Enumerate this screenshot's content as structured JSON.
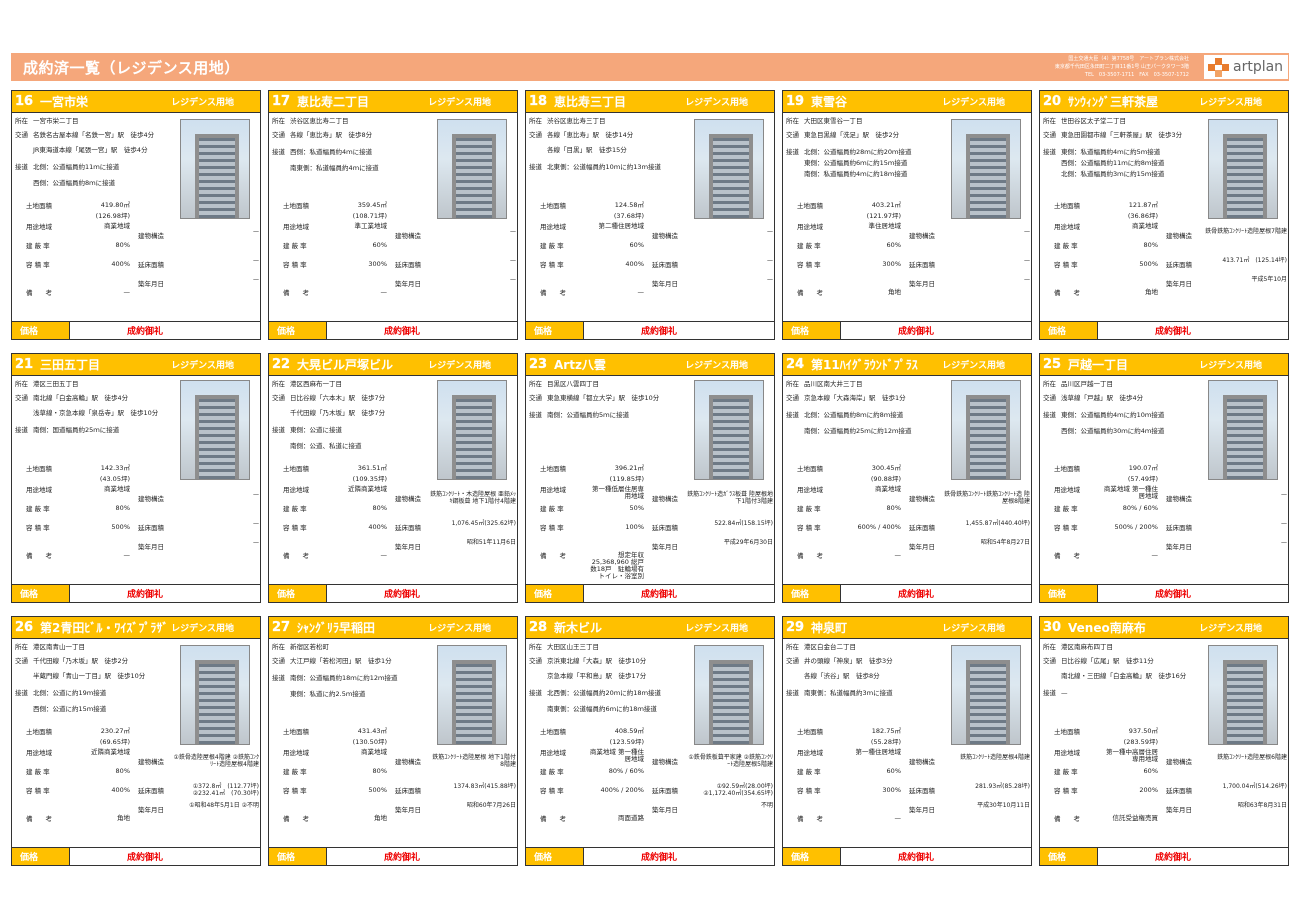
{
  "header": {
    "title": "成約済一覧（レジデンス用地）",
    "license": "国土交通大臣（4）第7758号　アートプラン株式会社",
    "address": "東京都千代田区永田町二丁目11番1号 山王パークタワー3階",
    "tel": "TEL　03-3507-1711　FAX　03-3507-1712"
  },
  "logo": {
    "text": "artplan"
  },
  "labels": {
    "location": "所在",
    "traffic": "交通",
    "road": "接道",
    "land_area": "土地面積",
    "zoning": "用途地域",
    "coverage": "建 蔽 率",
    "far": "容 積 率",
    "structure": "建物構造",
    "floor_area": "延床面積",
    "built": "築年月日",
    "remarks": "備　　考",
    "price": "価格",
    "price_value": "成約御礼"
  },
  "cards": [
    {
      "num": "16",
      "name": "一宮市栄",
      "type": "レジデンス用地",
      "location": "一宮市栄二丁目",
      "traffic": [
        "名鉄名古屋本線「名鉄一宮」駅　徒歩4分",
        "JR東海道本線「尾張一宮」駅　徒歩4分"
      ],
      "road": [
        "北側：公道幅員約11ｍに接道",
        "西側：公道幅員約8ｍに接道"
      ],
      "land_area": "419.80㎡",
      "land_tsubo": "(126.98坪)",
      "zoning": "商業地域",
      "coverage": "80%",
      "far": "400%",
      "structure": "—",
      "floor_area": "—",
      "built": "—",
      "remarks": "—"
    },
    {
      "num": "17",
      "name": "恵比寿二丁目",
      "type": "レジデンス用地",
      "location": "渋谷区恵比寿二丁目",
      "traffic": [
        "各線「恵比寿」駅　徒歩8分"
      ],
      "road": [
        "西側：私道幅員約4ｍに接道",
        "南東側：私道幅員約4ｍに接道"
      ],
      "land_area": "359.45㎡",
      "land_tsubo": "(108.71坪)",
      "zoning": "準工業地域",
      "coverage": "60%",
      "far": "300%",
      "structure": "—",
      "floor_area": "—",
      "built": "—",
      "remarks": "—"
    },
    {
      "num": "18",
      "name": "恵比寿三丁目",
      "type": "レジデンス用地",
      "location": "渋谷区恵比寿三丁目",
      "traffic": [
        "各線「恵比寿」駅　徒歩14分",
        "各線「目黒」駅　徒歩15分"
      ],
      "road": [
        "北東側：公道幅員約10ｍに約13ｍ接道"
      ],
      "land_area": "124.58㎡",
      "land_tsubo": "(37.68坪)",
      "zoning": "第二種住居地域",
      "coverage": "60%",
      "far": "400%",
      "structure": "—",
      "floor_area": "—",
      "built": "—",
      "remarks": "—"
    },
    {
      "num": "19",
      "name": "東雪谷",
      "type": "レジデンス用地",
      "location": "大田区東雪谷一丁目",
      "traffic": [
        "東急目黒線「洗足」駅　徒歩2分"
      ],
      "road": [
        "北側：公道幅員約28ｍに約20ｍ接道",
        "東側：公道幅員約6ｍに約15ｍ接道",
        "南側：私道幅員約4ｍに約18ｍ接道"
      ],
      "land_area": "403.21㎡",
      "land_tsubo": "(121.97坪)",
      "zoning": "準住居地域",
      "coverage": "60%",
      "far": "300%",
      "structure": "—",
      "floor_area": "—",
      "built": "—",
      "remarks": "角地"
    },
    {
      "num": "20",
      "name": "ｻﾝｳｨﾝｸﾞ三軒茶屋",
      "type": "レジデンス用地",
      "location": "世田谷区太子堂二丁目",
      "traffic": [
        "東急田園都市線「三軒茶屋」駅　徒歩3分"
      ],
      "road": [
        "東側：私道幅員約4ｍに約5ｍ接道",
        "西側：公道幅員約11ｍに約8ｍ接道",
        "北側：私道幅員約3ｍに約15ｍ接道"
      ],
      "land_area": "121.87㎡",
      "land_tsubo": "(36.86坪)",
      "zoning": "商業地域",
      "coverage": "80%",
      "far": "500%",
      "structure": "鉄骨鉄筋ｺﾝｸﾘｰﾄ造陸屋根7階建",
      "floor_area": "413.71㎡　(125.14坪)",
      "built": "平成5年10月",
      "remarks": "角地"
    },
    {
      "num": "21",
      "name": "三田五丁目",
      "type": "レジデンス用地",
      "location": "港区三田五丁目",
      "traffic": [
        "南北線「白金高輪」駅　徒歩4分",
        "浅草線・京急本線「泉岳寺」駅　徒歩10分"
      ],
      "road": [
        "南側：国道幅員約25ｍに接道"
      ],
      "land_area": "142.33㎡",
      "land_tsubo": "(43.05坪)",
      "zoning": "商業地域",
      "coverage": "80%",
      "far": "500%",
      "structure": "—",
      "floor_area": "—",
      "built": "—",
      "remarks": "—"
    },
    {
      "num": "22",
      "name": "大晃ビル戸塚ビル",
      "type": "レジデンス用地",
      "location": "港区西麻布一丁目",
      "traffic": [
        "日比谷線「六本木」駅　徒歩7分",
        "千代田線「乃木坂」駅　徒歩7分"
      ],
      "road": [
        "東側：公道に接道",
        "南側：公道、私道に接道"
      ],
      "land_area": "361.51㎡",
      "land_tsubo": "(109.35坪)",
      "zoning": "近隣商業地域",
      "coverage": "80%",
      "far": "400%",
      "structure": "鉄筋ｺﾝｸﾘｰﾄ・木造陸屋根 亜鉛ﾒｯｷ鋼板葺 地下1階付4階建",
      "floor_area": "1,076.45㎡(325.62坪)",
      "built": "昭和51年11月6日",
      "remarks": "—"
    },
    {
      "num": "23",
      "name": "Artz八雲",
      "type": "レジデンス用地",
      "location": "目黒区八雲四丁目",
      "traffic": [
        "東急東横線「都立大学」駅　徒歩10分"
      ],
      "road": [
        "南側：公道幅員約5ｍに接道"
      ],
      "land_area": "396.21㎡",
      "land_tsubo": "(119.85坪)",
      "zoning": "第一種低層住居専用地域",
      "coverage": "50%",
      "far": "100%",
      "structure": "鉄筋ｺﾝｸﾘｰﾄ造ｶﾞﾗｽ板葺 陸屋根地下1階付3階建",
      "floor_area": "522.84㎡(158.15坪)",
      "built": "平成29年6月30日",
      "remarks": "想定年収　25,368,960 総戸数18戸　駐輪場有 トイレ・浴室別"
    },
    {
      "num": "24",
      "name": "第11ﾊｲｸﾞﾗｳﾝﾄﾞﾌﾟﾗｽ",
      "type": "レジデンス用地",
      "location": "品川区南大井三丁目",
      "traffic": [
        "京急本線「大森海岸」駅　徒歩1分"
      ],
      "road": [
        "北側：公道幅員約8ｍに約8ｍ接道",
        "南側：公道幅員約25ｍに約12ｍ接道"
      ],
      "land_area": "300.45㎡",
      "land_tsubo": "(90.88坪)",
      "zoning": "商業地域",
      "coverage": "80%",
      "far": "600% / 400%",
      "structure": "鉄骨鉄筋ｺﾝｸﾘｰﾄ鉄筋ｺﾝｸﾘｰﾄ造 陸屋根8階建",
      "floor_area": "1,455.87㎡(440.40坪)",
      "built": "昭和54年8月27日",
      "remarks": "—"
    },
    {
      "num": "25",
      "name": "戸越一丁目",
      "type": "レジデンス用地",
      "location": "品川区戸越一丁目",
      "traffic": [
        "浅草線「戸越」駅　徒歩4分"
      ],
      "road": [
        "東側：公道幅員約4ｍに約10ｍ接道",
        "西側：公道幅員約30ｍに約4ｍ接道"
      ],
      "land_area": "190.07㎡",
      "land_tsubo": "(57.49坪)",
      "zoning": "商業地域 第一種住居地域",
      "coverage": "80% / 60%",
      "far": "500% / 200%",
      "structure": "—",
      "floor_area": "—",
      "built": "—",
      "remarks": "—"
    },
    {
      "num": "26",
      "name": "第2青田ﾋﾞﾙ・ﾜｲｽﾞﾌﾟﾗｻﾞ",
      "type": "レジデンス用地",
      "location": "港区南青山一丁目",
      "traffic": [
        "千代田線「乃木坂」駅　徒歩2分",
        "半蔵門線「青山一丁目」駅　徒歩10分"
      ],
      "road": [
        "北側：公道に約19ｍ接道",
        "西側：公道に約15ｍ接道"
      ],
      "land_area": "230.27㎡",
      "land_tsubo": "(69.65坪)",
      "zoning": "近隣商業地域",
      "coverage": "80%",
      "far": "400%",
      "structure": "①鉄骨造陸屋根4階建 ②鉄筋ｺﾝｸﾘｰﾄ造陸屋根4階建",
      "floor_area": "①372.8㎡　(112.77坪) ②232.41㎡　(70.30坪)",
      "built": "①昭和48年5月1日 ②不明",
      "remarks": "角地"
    },
    {
      "num": "27",
      "name": "ｼｬﾝｸﾞﾘﾗ早稲田",
      "type": "レジデンス用地",
      "location": "新宿区若松町",
      "traffic": [
        "大江戸線「若松河田」駅　徒歩1分"
      ],
      "road": [
        "南側：公道幅員約18ｍに約12ｍ接道",
        "東側：私道に約2.5ｍ接道"
      ],
      "land_area": "431.43㎡",
      "land_tsubo": "(130.50坪)",
      "zoning": "商業地域",
      "coverage": "80%",
      "far": "500%",
      "structure": "鉄筋ｺﾝｸﾘｰﾄ造陸屋根 地下1階付8階建",
      "floor_area": "1374.83㎡(415.88坪)",
      "built": "昭和60年7月26日",
      "remarks": "角地"
    },
    {
      "num": "28",
      "name": "新木ビル",
      "type": "レジデンス用地",
      "location": "大田区山王三丁目",
      "traffic": [
        "京浜東北線「大森」駅　徒歩10分",
        "京急本線「平和島」駅　徒歩17分"
      ],
      "road": [
        "北西側：公道幅員約20ｍに約18ｍ接道",
        "南東側：公道幅員約6ｍに約18ｍ接道"
      ],
      "land_area": "408.59㎡",
      "land_tsubo": "(123.59坪)",
      "zoning": "商業地域 第一種住居地域",
      "coverage": "80% / 60%",
      "far": "400% / 200%",
      "structure": "①鉄骨鉄板葺平家建 ②鉄筋ｺﾝｸﾘｰﾄ造陸屋根5階建",
      "floor_area": "①92.59㎡(28.00坪) ②1,172.40㎡(354.65坪)",
      "built": "不明",
      "remarks": "両面道路"
    },
    {
      "num": "29",
      "name": "神泉町",
      "type": "レジデンス用地",
      "location": "港区白金台二丁目",
      "traffic": [
        "井の頭線「神泉」駅　徒歩3分",
        "各線「渋谷」駅　徒歩8分"
      ],
      "road": [
        "南東側：私道幅員約3ｍに接道"
      ],
      "land_area": "182.75㎡",
      "land_tsubo": "(55.28坪)",
      "zoning": "第一種住居地域",
      "coverage": "60%",
      "far": "300%",
      "structure": "鉄筋ｺﾝｸﾘｰﾄ造陸屋根4階建",
      "floor_area": "281.93㎡(85.28坪)",
      "built": "平成30年10月11日",
      "remarks": "—"
    },
    {
      "num": "30",
      "name": "Veneo南麻布",
      "type": "レジデンス用地",
      "location": "港区南麻布四丁目",
      "traffic": [
        "日比谷線「広尾」駅　徒歩11分",
        "南北線・三田線「白金高輪」駅　徒歩16分"
      ],
      "road": [
        "—"
      ],
      "land_area": "937.50㎡",
      "land_tsubo": "(283.59坪)",
      "zoning": "第一種中高層住居専用地域",
      "coverage": "60%",
      "far": "200%",
      "structure": "鉄筋ｺﾝｸﾘｰﾄ造陸屋根6階建",
      "floor_area": "1,700.04㎡(514.26坪)",
      "built": "昭和63年8月31日",
      "remarks": "信託受益権売買"
    }
  ]
}
